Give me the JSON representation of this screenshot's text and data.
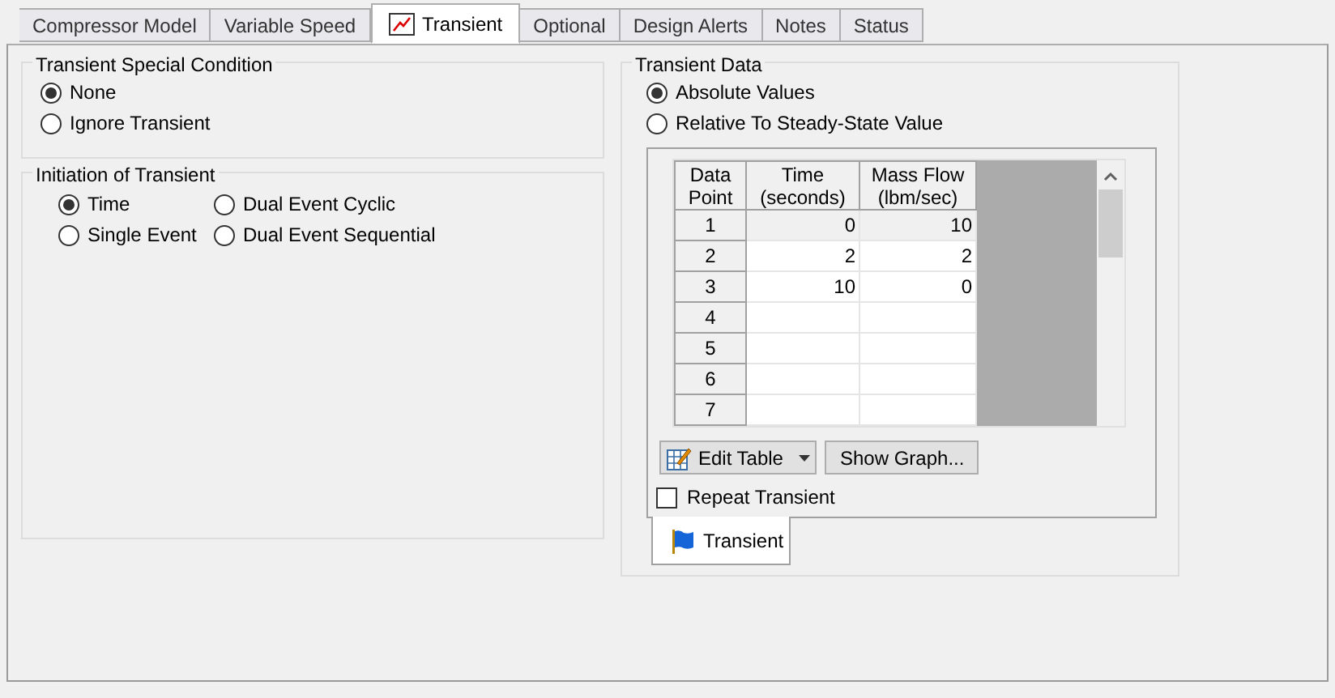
{
  "tabs": [
    {
      "label": "Compressor Model",
      "selected": false,
      "icon": false
    },
    {
      "label": "Variable Speed",
      "selected": false,
      "icon": false
    },
    {
      "label": "Transient",
      "selected": true,
      "icon": true
    },
    {
      "label": "Optional",
      "selected": false,
      "icon": false
    },
    {
      "label": "Design Alerts",
      "selected": false,
      "icon": false
    },
    {
      "label": "Notes",
      "selected": false,
      "icon": false
    },
    {
      "label": "Status",
      "selected": false,
      "icon": false
    }
  ],
  "special_condition": {
    "title": "Transient Special Condition",
    "options": [
      {
        "label": "None",
        "selected": true
      },
      {
        "label": "Ignore Transient",
        "selected": false
      }
    ]
  },
  "initiation": {
    "title": "Initiation of Transient",
    "options": [
      {
        "label": "Time",
        "selected": true
      },
      {
        "label": "Dual Event Cyclic",
        "selected": false
      },
      {
        "label": "Single Event",
        "selected": false
      },
      {
        "label": "Dual Event Sequential",
        "selected": false
      }
    ]
  },
  "transient_data": {
    "title": "Transient Data",
    "options": [
      {
        "label": "Absolute Values",
        "selected": true
      },
      {
        "label": "Relative To Steady-State Value",
        "selected": false
      }
    ],
    "table": {
      "columns": [
        "Data Point",
        "Time (seconds)",
        "Mass Flow (lbm/sec)"
      ],
      "rows": [
        {
          "point": "1",
          "time": "0",
          "mass_flow": "10",
          "selected": true
        },
        {
          "point": "2",
          "time": "2",
          "mass_flow": "2",
          "selected": false
        },
        {
          "point": "3",
          "time": "10",
          "mass_flow": "0",
          "selected": false
        },
        {
          "point": "4",
          "time": "",
          "mass_flow": "",
          "selected": false
        },
        {
          "point": "5",
          "time": "",
          "mass_flow": "",
          "selected": false
        },
        {
          "point": "6",
          "time": "",
          "mass_flow": "",
          "selected": false
        },
        {
          "point": "7",
          "time": "",
          "mass_flow": "",
          "selected": false
        }
      ]
    },
    "edit_table_button": "Edit Table",
    "show_graph_button": "Show Graph...",
    "repeat_transient": {
      "label": "Repeat Transient",
      "checked": false
    },
    "inner_tab": {
      "label": "Transient",
      "selected": true
    }
  }
}
